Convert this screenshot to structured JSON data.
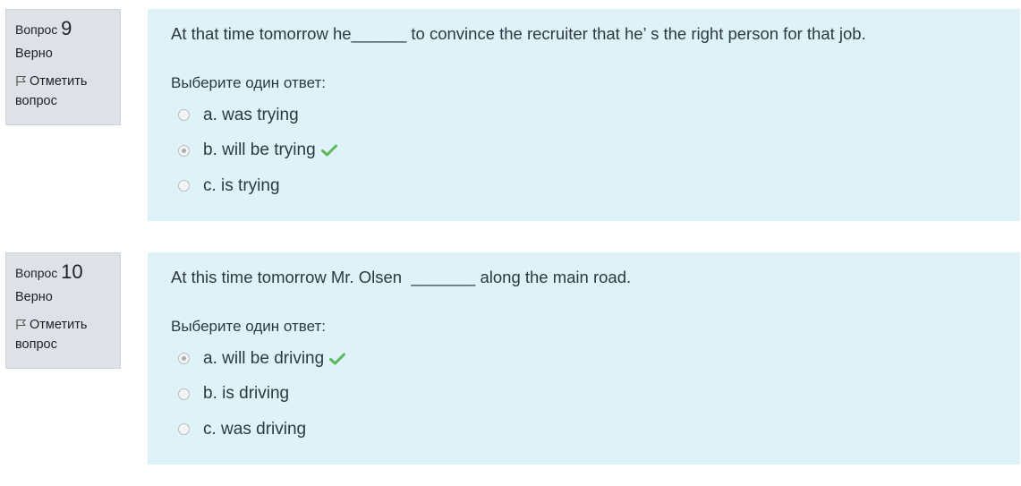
{
  "questions": [
    {
      "label": "Вопрос",
      "number": "9",
      "state": "Верно",
      "flag_label": "Отметить вопрос",
      "text": "At that time tomorrow he______ to convince the recruiter that he’ s the right person for that job.",
      "prompt": "Выберите один ответ:",
      "answers": [
        {
          "label": "a. was trying",
          "selected": false,
          "correct": false
        },
        {
          "label": "b. will be trying",
          "selected": true,
          "correct": true
        },
        {
          "label": "c. is trying",
          "selected": false,
          "correct": false
        }
      ]
    },
    {
      "label": "Вопрос",
      "number": "10",
      "state": "Верно",
      "flag_label": "Отметить вопрос",
      "text": "At this time tomorrow Mr. Olsen  _______ along the main road.",
      "prompt": "Выберите один ответ:",
      "answers": [
        {
          "label": "a. will be driving",
          "selected": true,
          "correct": true
        },
        {
          "label": "b. is driving",
          "selected": false,
          "correct": false
        },
        {
          "label": "c. was driving",
          "selected": false,
          "correct": false
        }
      ]
    }
  ],
  "colors": {
    "info_bg": "#dee2e6",
    "content_bg": "#def2f8",
    "correct_check": "#5cb85c"
  },
  "icons": {
    "flag": "flag-icon",
    "correct": "check-icon"
  }
}
